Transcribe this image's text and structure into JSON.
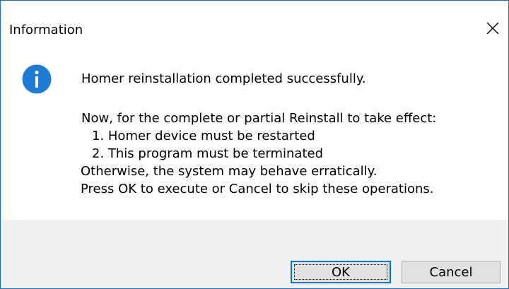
{
  "window": {
    "title": "Information",
    "close_icon": "close-icon"
  },
  "message": {
    "icon": "info-icon",
    "icon_color": "#1e7bd6",
    "headline": "Homer reinstallation completed successfully.",
    "lines": [
      "Now, for the complete or partial Reinstall to take effect:",
      "1. Homer device must be restarted",
      "2. This program must be terminated",
      "Otherwise, the system may behave erratically.",
      "Press OK to execute or Cancel to skip these operations."
    ]
  },
  "buttons": {
    "ok_label": "OK",
    "cancel_label": "Cancel"
  },
  "colors": {
    "accent": "#0078d7",
    "footer_bg": "#f0f0f0"
  }
}
